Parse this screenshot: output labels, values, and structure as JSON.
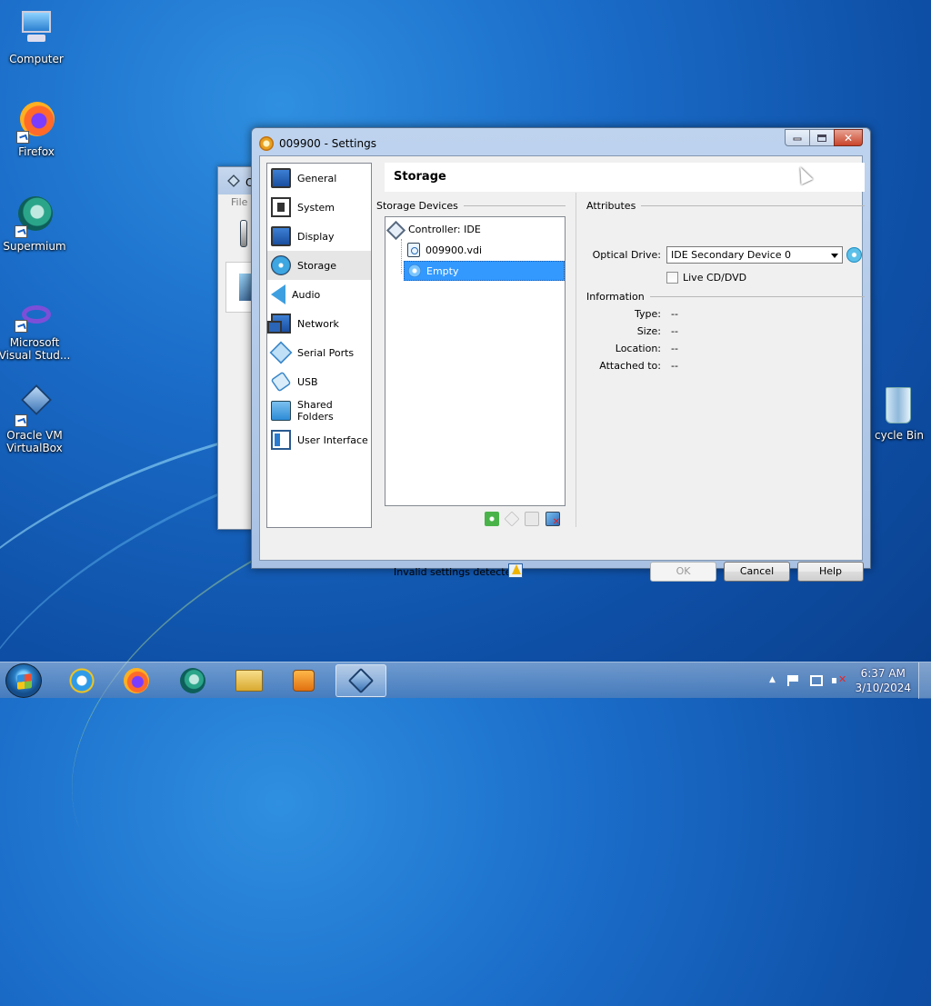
{
  "desktop": {
    "icons": [
      {
        "label": "Computer"
      },
      {
        "label": "Firefox"
      },
      {
        "label": "Supermium"
      },
      {
        "label": "Microsoft Visual Stud..."
      },
      {
        "label": "Oracle VM VirtualBox"
      },
      {
        "label": "cycle Bin"
      }
    ]
  },
  "background_window": {
    "title_partial": "O",
    "menu_partial": "File"
  },
  "settings_window": {
    "title": "009900 - Settings",
    "nav_items": [
      {
        "label": "General",
        "icon": "monitor-icon"
      },
      {
        "label": "System",
        "icon": "chip-icon"
      },
      {
        "label": "Display",
        "icon": "display-icon"
      },
      {
        "label": "Storage",
        "icon": "disc-icon",
        "selected": true
      },
      {
        "label": "Audio",
        "icon": "speaker-icon"
      },
      {
        "label": "Network",
        "icon": "network-icon"
      },
      {
        "label": "Serial Ports",
        "icon": "serial-port-icon"
      },
      {
        "label": "USB",
        "icon": "usb-icon"
      },
      {
        "label": "Shared Folders",
        "icon": "folder-icon"
      },
      {
        "label": "User Interface",
        "icon": "ui-icon"
      }
    ],
    "page_title": "Storage",
    "storage_devices": {
      "title": "Storage Devices",
      "controller": "Controller: IDE",
      "devices": [
        {
          "label": "009900.vdi",
          "icon": "hard-disk-icon"
        },
        {
          "label": "Empty",
          "icon": "optical-disc-icon",
          "selected": true
        }
      ]
    },
    "attributes": {
      "title": "Attributes",
      "optical_drive_label": "Optical Drive:",
      "optical_drive_value": "IDE Secondary Device 0",
      "live_cd_label": "Live CD/DVD",
      "live_cd_checked": false
    },
    "information": {
      "title": "Information",
      "rows": [
        {
          "label": "Type:",
          "value": "--"
        },
        {
          "label": "Size:",
          "value": "--"
        },
        {
          "label": "Location:",
          "value": "--"
        },
        {
          "label": "Attached to:",
          "value": "--"
        }
      ]
    },
    "status_text": "Invalid settings detected",
    "buttons": {
      "ok": "OK",
      "cancel": "Cancel",
      "help": "Help"
    }
  },
  "taskbar": {
    "time": "6:37 AM",
    "date": "3/10/2024"
  }
}
